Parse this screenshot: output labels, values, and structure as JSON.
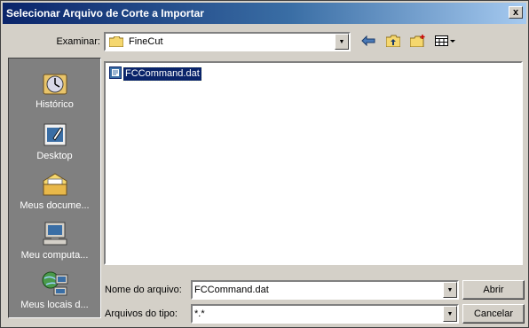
{
  "window": {
    "title": "Selecionar Arquivo de Corte a Importar",
    "close_glyph": "x"
  },
  "lookin": {
    "label": "Examinar:",
    "value": "FineCut",
    "folder_icon": "folder-icon"
  },
  "toolbar": {
    "icons": [
      "back-icon",
      "up-folder-icon",
      "new-folder-icon",
      "view-menu-icon"
    ]
  },
  "places": [
    {
      "label": "Histórico",
      "icon": "history-icon"
    },
    {
      "label": "Desktop",
      "icon": "desktop-icon"
    },
    {
      "label": "Meus docume...",
      "icon": "my-documents-icon"
    },
    {
      "label": "Meu computa...",
      "icon": "my-computer-icon"
    },
    {
      "label": "Meus locais d...",
      "icon": "network-places-icon"
    }
  ],
  "files": [
    {
      "name": "FCCommand.dat",
      "selected": true,
      "icon": "file-icon"
    }
  ],
  "filename": {
    "label": "Nome do arquivo:",
    "value": "FCCommand.dat"
  },
  "filetype": {
    "label": "Arquivos do tipo:",
    "value": "*.*"
  },
  "buttons": {
    "open": "Abrir",
    "cancel": "Cancelar"
  },
  "colors": {
    "title_bar": "#0a246a",
    "face": "#d4d0c8",
    "places_bar": "#808080",
    "selection": "#0a246a"
  }
}
